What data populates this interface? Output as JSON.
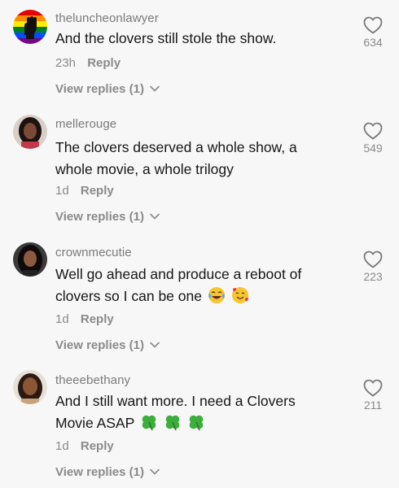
{
  "comments": [
    {
      "username": "theluncheonlawyer",
      "text": "And the clovers still stole the show.",
      "time": "23h",
      "reply_label": "Reply",
      "likes": "634",
      "view_replies": "View replies (1)"
    },
    {
      "username": "mellerouge",
      "text": "The clovers deserved a whole show, a whole movie, a whole trilogy",
      "time": "1d",
      "reply_label": "Reply",
      "likes": "549",
      "view_replies": "View replies (1)"
    },
    {
      "username": "crownmecutie",
      "text": "Well go ahead and produce a reboot of clovers so I can be one",
      "emojis": [
        "face-with-tears-of-joy",
        "smiling-face-with-hearts"
      ],
      "time": "1d",
      "reply_label": "Reply",
      "likes": "223",
      "view_replies": "View replies (1)"
    },
    {
      "username": "theeebethany",
      "text": "And I still want more. I need a Clovers Movie ASAP",
      "emojis": [
        "four-leaf-clover",
        "four-leaf-clover",
        "four-leaf-clover"
      ],
      "time": "1d",
      "reply_label": "Reply",
      "likes": "211",
      "view_replies": "View replies (1)"
    }
  ],
  "colors": {
    "background": "#f7f7f7",
    "text": "#161616",
    "muted": "#8a8a8a"
  }
}
